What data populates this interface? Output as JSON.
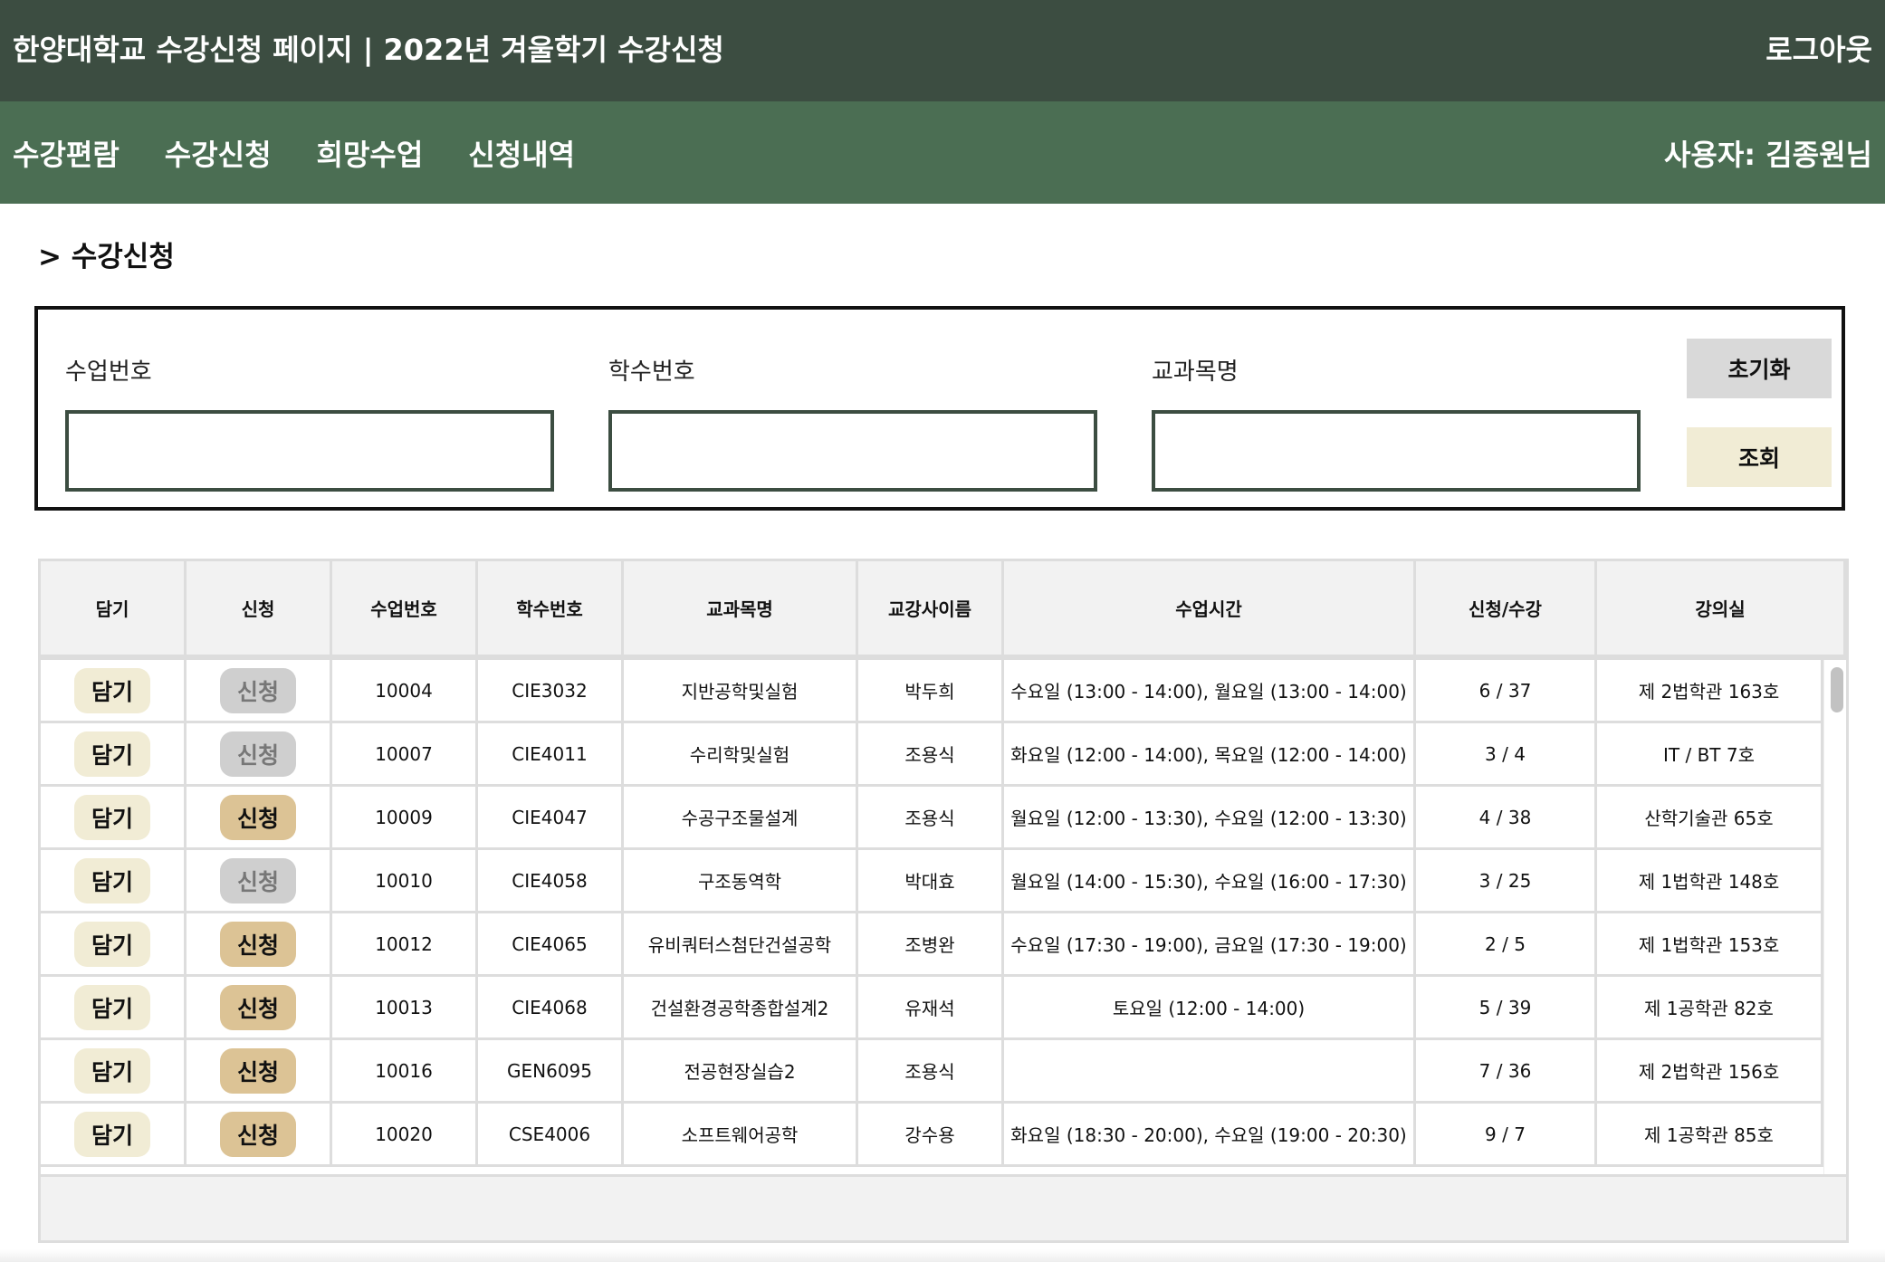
{
  "header": {
    "title": "한양대학교 수강신청 페이지 | 2022년 겨울학기 수강신청",
    "logout_label": "로그아웃"
  },
  "nav": {
    "items": [
      {
        "label": "수강편람"
      },
      {
        "label": "수강신청"
      },
      {
        "label": "희망수업"
      },
      {
        "label": "신청내역"
      }
    ],
    "user_label": "사용자: 김종원님"
  },
  "page": {
    "heading": "> 수강신청"
  },
  "search": {
    "class_no_label": "수업번호",
    "class_no_value": "",
    "course_no_label": "학수번호",
    "course_no_value": "",
    "course_name_label": "교과목명",
    "course_name_value": "",
    "reset_label": "초기화",
    "search_label": "조회"
  },
  "table": {
    "headers": [
      "담기",
      "신청",
      "수업번호",
      "학수번호",
      "교과목명",
      "교강사이름",
      "수업시간",
      "신청/수강",
      "강의실"
    ],
    "rows": [
      {
        "cart": "담기",
        "apply": "신청",
        "apply_enabled": false,
        "class_no": "10004",
        "course_no": "CIE3032",
        "name": "지반공학및실험",
        "instructor": "박두희",
        "time": "수요일 (13:00 - 14:00), 월요일 (13:00 - 14:00)",
        "count": "6 / 37",
        "room": "제 2법학관 163호"
      },
      {
        "cart": "담기",
        "apply": "신청",
        "apply_enabled": false,
        "class_no": "10007",
        "course_no": "CIE4011",
        "name": "수리학및실험",
        "instructor": "조용식",
        "time": "화요일 (12:00 - 14:00), 목요일 (12:00 - 14:00)",
        "count": "3 / 4",
        "room": "IT / BT 7호"
      },
      {
        "cart": "담기",
        "apply": "신청",
        "apply_enabled": true,
        "class_no": "10009",
        "course_no": "CIE4047",
        "name": "수공구조물설계",
        "instructor": "조용식",
        "time": "월요일 (12:00 - 13:30), 수요일 (12:00 - 13:30)",
        "count": "4 / 38",
        "room": "산학기술관 65호"
      },
      {
        "cart": "담기",
        "apply": "신청",
        "apply_enabled": false,
        "class_no": "10010",
        "course_no": "CIE4058",
        "name": "구조동역학",
        "instructor": "박대효",
        "time": "월요일 (14:00 - 15:30), 수요일 (16:00 - 17:30)",
        "count": "3 / 25",
        "room": "제 1법학관 148호"
      },
      {
        "cart": "담기",
        "apply": "신청",
        "apply_enabled": true,
        "class_no": "10012",
        "course_no": "CIE4065",
        "name": "유비쿼터스첨단건설공학",
        "instructor": "조병완",
        "time": "수요일 (17:30 - 19:00), 금요일 (17:30 - 19:00)",
        "count": "2 / 5",
        "room": "제 1법학관 153호"
      },
      {
        "cart": "담기",
        "apply": "신청",
        "apply_enabled": true,
        "class_no": "10013",
        "course_no": "CIE4068",
        "name": "건설환경공학종합설계2",
        "instructor": "유재석",
        "time": "토요일 (12:00 - 14:00)",
        "count": "5 / 39",
        "room": "제 1공학관 82호"
      },
      {
        "cart": "담기",
        "apply": "신청",
        "apply_enabled": true,
        "class_no": "10016",
        "course_no": "GEN6095",
        "name": "전공현장실습2",
        "instructor": "조용식",
        "time": "",
        "count": "7 / 36",
        "room": "제 2법학관 156호"
      },
      {
        "cart": "담기",
        "apply": "신청",
        "apply_enabled": true,
        "class_no": "10020",
        "course_no": "CSE4006",
        "name": "소프트웨어공학",
        "instructor": "강수용",
        "time": "화요일 (18:30 - 20:00), 수요일 (19:00 - 20:30)",
        "count": "9 / 7",
        "room": "제 1공학관 85호"
      }
    ]
  },
  "colors": {
    "header_bg": "#3c4d41",
    "nav_bg": "#4b6e53",
    "cart_button": "#f1ecd5",
    "apply_enabled": "#dcc395",
    "apply_disabled": "#cfcfcf"
  }
}
